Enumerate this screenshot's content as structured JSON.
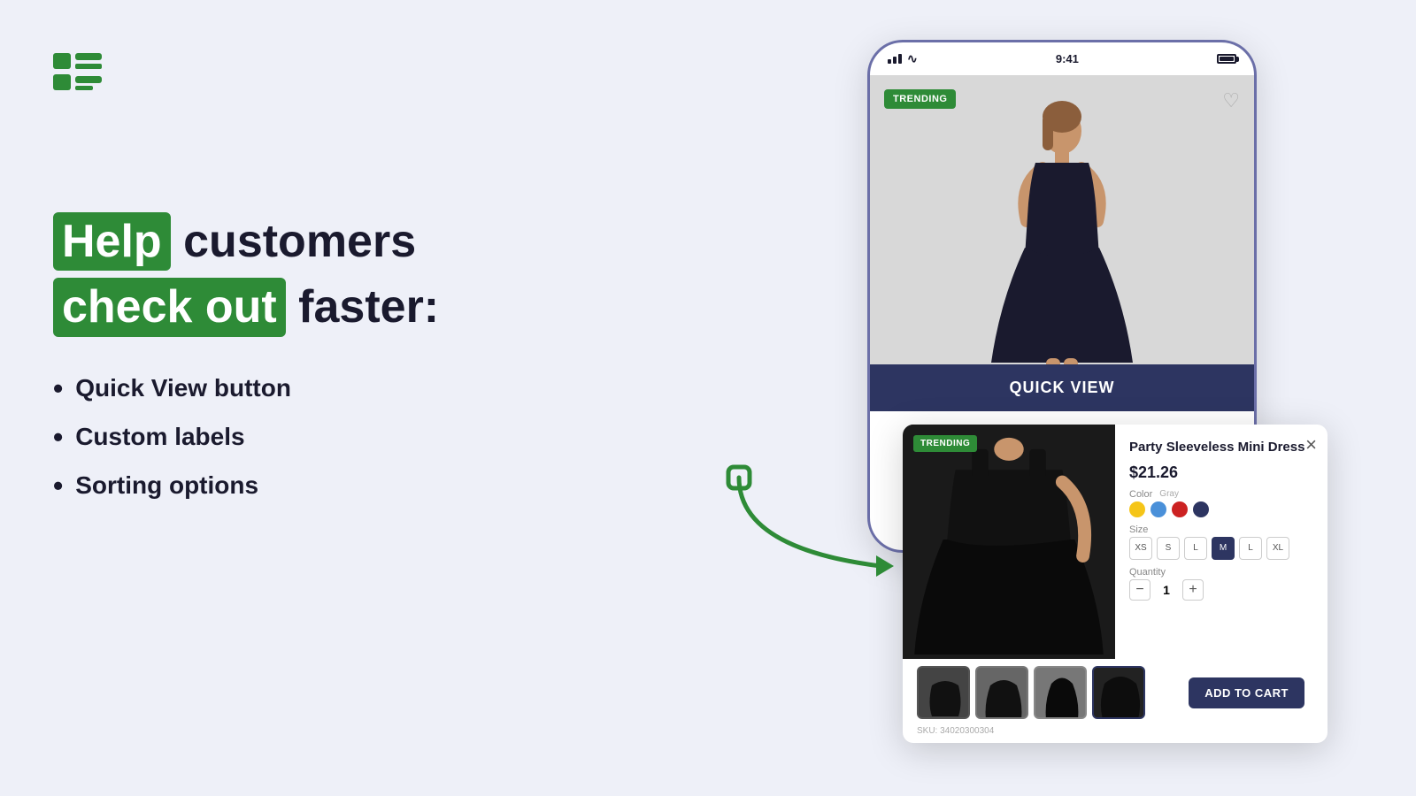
{
  "logo": {
    "alt": "App logo"
  },
  "hero": {
    "line1_prefix": "",
    "line1_highlight": "Help",
    "line1_suffix": " customers",
    "line2_highlight": "check out",
    "line2_suffix": " faster:",
    "bullets": [
      "Quick View button",
      "Custom labels",
      "Sorting options"
    ]
  },
  "phone": {
    "time": "9:41",
    "trending_badge": "TRENDING",
    "quick_view_label": "QUICK VIEW"
  },
  "popup": {
    "trending_badge": "TRENDING",
    "close_label": "×",
    "product_title": "Party Sleeveless Mini Dress",
    "price": "$21.26",
    "color_label": "Color",
    "size_label": "Size",
    "quantity_label": "Quantity",
    "colors": [
      {
        "name": "yellow",
        "hex": "#f5c518"
      },
      {
        "name": "blue-light",
        "hex": "#4a90d9"
      },
      {
        "name": "red",
        "hex": "#cc2222"
      },
      {
        "name": "navy",
        "hex": "#2d3561"
      }
    ],
    "sizes": [
      "XS",
      "S",
      "L",
      "M",
      "L",
      "XL"
    ],
    "selected_size": "M",
    "quantity": "1",
    "sku": "SKU: 34020300304",
    "add_to_cart_label": "ADD TO CART",
    "thumbnails": [
      {
        "label": "thumb1",
        "active": false
      },
      {
        "label": "thumb2",
        "active": false
      },
      {
        "label": "thumb3",
        "active": false
      },
      {
        "label": "thumb4",
        "active": true
      }
    ]
  },
  "arrow": {
    "color": "#2e8b37"
  }
}
